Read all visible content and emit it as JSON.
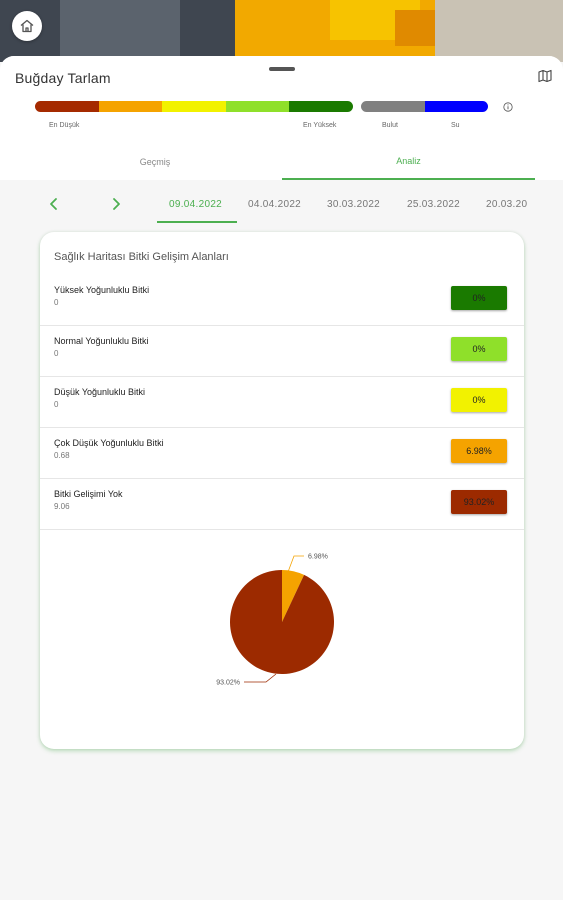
{
  "header": {
    "title": "Buğday Tarlam",
    "home_icon": "home-icon",
    "map_icon": "map-icon",
    "info_icon": "info-icon"
  },
  "legend": {
    "scale_colors": [
      "#a52a00",
      "#f5a300",
      "#f2f200",
      "#8fe02a",
      "#1a7a00"
    ],
    "other_colors": [
      "#808080",
      "#0000ff"
    ],
    "labels": {
      "lowest": "En Düşük",
      "highest": "En Yüksek",
      "cloud": "Bulut",
      "water": "Su"
    }
  },
  "tabs": [
    {
      "label": "Geçmiş"
    },
    {
      "label": "Analiz"
    }
  ],
  "dates": [
    "09.04.2022",
    "04.04.2022",
    "30.03.2022",
    "25.03.2022",
    "20.03.20"
  ],
  "card": {
    "title": "Sağlık Haritası Bitki Gelişim Alanları",
    "rows": [
      {
        "label": "Yüksek Yoğunluklu Bitki",
        "value": "0",
        "percent": "0%",
        "color": "#1a7a00"
      },
      {
        "label": "Normal Yoğunluklu Bitki",
        "value": "0",
        "percent": "0%",
        "color": "#8fe02a"
      },
      {
        "label": "Düşük Yoğunluklu Bitki",
        "value": "0",
        "percent": "0%",
        "color": "#f2f200"
      },
      {
        "label": "Çok Düşük Yoğunluklu Bitki",
        "value": "0.68",
        "percent": "6.98%",
        "color": "#f5a300"
      },
      {
        "label": "Bitki Gelişimi Yok",
        "value": "9.06",
        "percent": "93.02%",
        "color": "#9c2a00"
      }
    ]
  },
  "chart_data": {
    "type": "pie",
    "slices": [
      {
        "label": "6.98%",
        "value": 6.98,
        "color": "#f5a300"
      },
      {
        "label": "93.02%",
        "value": 93.02,
        "color": "#9c2a00"
      }
    ]
  }
}
